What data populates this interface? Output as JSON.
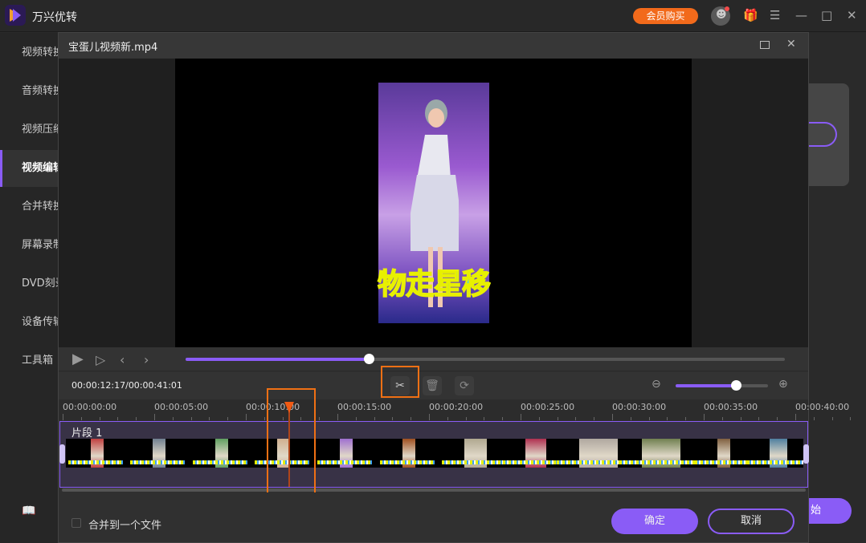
{
  "app": {
    "title": "万兴优转",
    "vip_label": "会员购买",
    "accent": "#8a5cf6",
    "vip_color": "#f26a1b"
  },
  "sidebar": {
    "items": [
      {
        "label": "视频转换"
      },
      {
        "label": "音频转换"
      },
      {
        "label": "视频压缩"
      },
      {
        "label": "视频编辑",
        "active": true
      },
      {
        "label": "合并转换"
      },
      {
        "label": "屏幕录制"
      },
      {
        "label": "DVD刻录"
      },
      {
        "label": "设备传输"
      },
      {
        "label": "工具箱"
      }
    ]
  },
  "background": {
    "start_label": "始"
  },
  "editor": {
    "title": "宝蛋儿视频新.mp4",
    "caption": "物走星移",
    "playback_progress_percent": 30.6,
    "timecode": "00:00:12:17/00:00:41:01",
    "zoom_level_percent": 65,
    "ruler_labels": [
      "00:00:00:00",
      "00:00:05:00",
      "00:00:10:00",
      "00:00:15:00",
      "00:00:20:00",
      "00:00:25:00",
      "00:00:30:00",
      "00:00:35:00",
      "00:00:40:00"
    ],
    "segment_label": "片段 1",
    "merge_label": "合并到一个文件",
    "merge_checked": false,
    "ok_label": "确定",
    "cancel_label": "取消",
    "highlight_color": "#f07014"
  }
}
